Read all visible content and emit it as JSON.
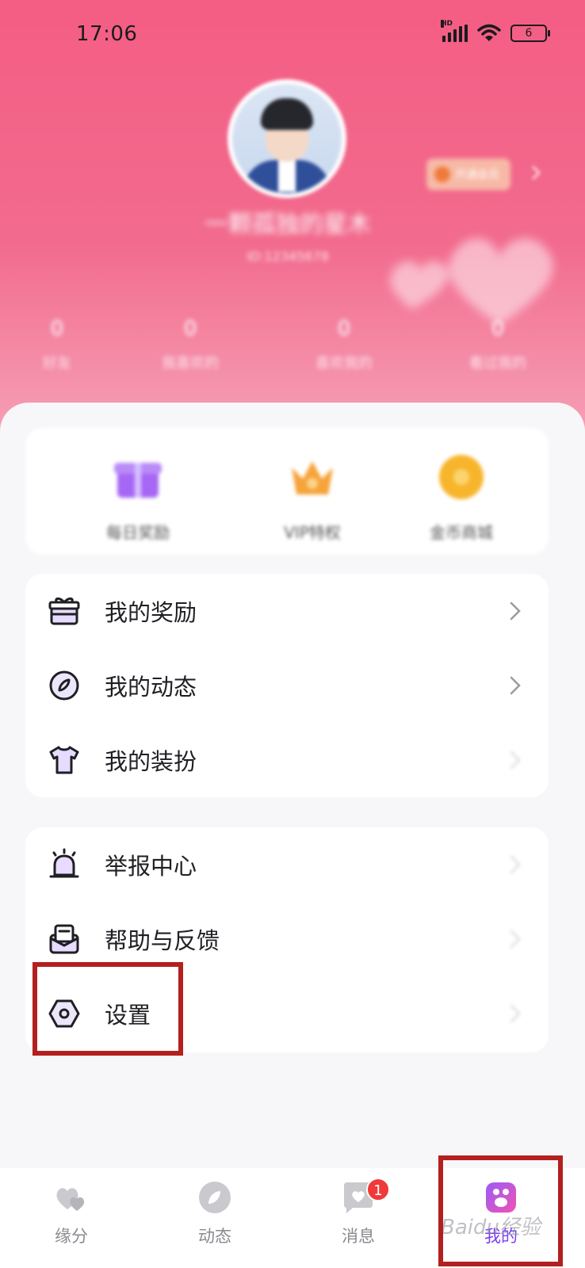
{
  "status_bar": {
    "time": "17:06",
    "network_label": "HD",
    "battery_level": "6"
  },
  "profile": {
    "nickname": "一颗孤独的星木",
    "uid_text": "ID:12345678",
    "vip_badge_label": "开通会员",
    "stats": [
      {
        "value": "0",
        "label": "好友"
      },
      {
        "value": "0",
        "label": "我喜欢的"
      },
      {
        "value": "0",
        "label": "喜欢我的"
      },
      {
        "value": "0",
        "label": "看过我的"
      }
    ]
  },
  "quick_actions": [
    {
      "label": "每日奖励",
      "color": "#a667f5"
    },
    {
      "label": "VIP特权",
      "color": "#f6a33a"
    },
    {
      "label": "金币商城",
      "color": "#f7b52c"
    }
  ],
  "menu_group_1": [
    {
      "label": "我的奖励",
      "icon": "gift-icon"
    },
    {
      "label": "我的动态",
      "icon": "compass-icon"
    },
    {
      "label": "我的装扮",
      "icon": "tshirt-icon"
    }
  ],
  "menu_group_2": [
    {
      "label": "举报中心",
      "icon": "alarm-icon"
    },
    {
      "label": "帮助与反馈",
      "icon": "mail-feedback-icon"
    },
    {
      "label": "设置",
      "icon": "settings-hexagon-icon"
    }
  ],
  "tabbar": {
    "tabs": [
      {
        "label": "缘分",
        "icon": "hearts-icon"
      },
      {
        "label": "动态",
        "icon": "leaf-icon"
      },
      {
        "label": "消息",
        "icon": "message-heart-icon",
        "badge": "1"
      },
      {
        "label": "我的",
        "icon": "paw-icon",
        "active": true
      }
    ]
  },
  "watermark": "Baidu经验",
  "colors": {
    "header_pink": "#f45d84",
    "accent_purple": "#7a3df2",
    "highlight_red": "#b3201f",
    "badge_red": "#f03a3a"
  }
}
